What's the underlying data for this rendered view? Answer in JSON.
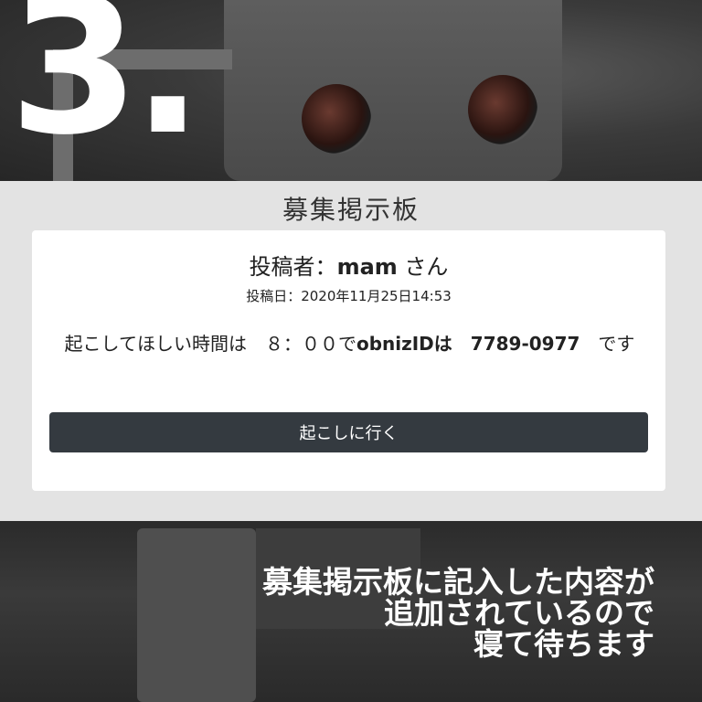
{
  "step_number": "3.",
  "board": {
    "title": "募集掲示板",
    "poster_prefix": "投稿者：",
    "poster_name": "mam",
    "poster_suffix": " さん",
    "post_date": "投稿日：2020年11月25日14:53",
    "message": {
      "part1": "起こしてほしい時間は　",
      "time": "８：００",
      "part2": "で",
      "id_label": "obnizIDは",
      "spacer": "　",
      "obniz_id": "7789-0977",
      "part3": "　です"
    },
    "button_label": "起こしに行く",
    "button_color": "#343a40"
  },
  "caption": {
    "line1": "募集掲示板に記入した内容が",
    "line2": "追加されているので",
    "line3": "寝て待ちます"
  }
}
